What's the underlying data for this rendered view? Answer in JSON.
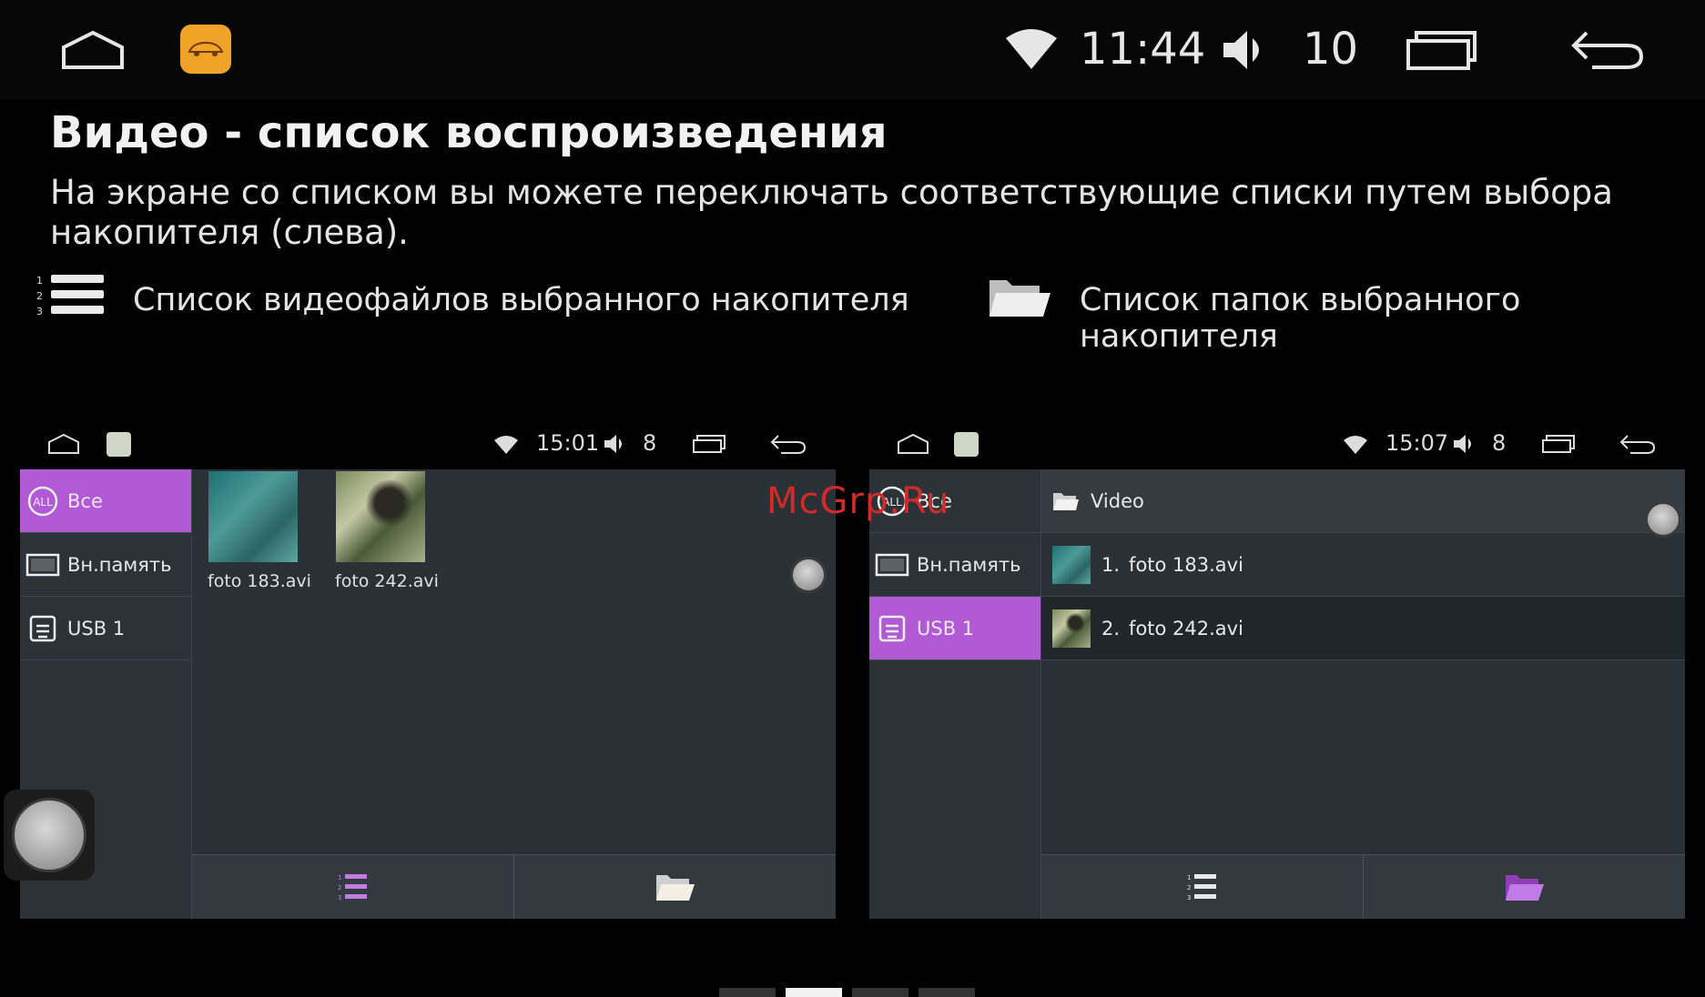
{
  "status_bar": {
    "time": "11:44",
    "volume": "10"
  },
  "heading": {
    "title": "Видео - список воспроизведения",
    "description": "На экране со списком вы можете переключать соответствующие списки путем выбора накопителя (слева)."
  },
  "legend": {
    "list_label": "Список видеофайлов выбранного накопителя",
    "folder_label": "Список папок выбранного накопителя"
  },
  "left_screen": {
    "time": "15:01",
    "volume": "8",
    "sidebar": [
      {
        "label": "Все",
        "icon": "all-icon",
        "active": true
      },
      {
        "label": "Вн.память",
        "icon": "memory-icon",
        "active": false
      },
      {
        "label": "USB 1",
        "icon": "usb-icon",
        "active": false
      }
    ],
    "files": [
      {
        "name": "foto 183.avi"
      },
      {
        "name": "foto 242.avi"
      }
    ]
  },
  "right_screen": {
    "time": "15:07",
    "volume": "8",
    "sidebar": [
      {
        "label": "Все",
        "icon": "all-icon",
        "active": false
      },
      {
        "label": "Вн.память",
        "icon": "memory-icon",
        "active": false
      },
      {
        "label": "USB 1",
        "icon": "usb-icon",
        "active": true
      }
    ],
    "folder": "Video",
    "items": [
      {
        "index": "1.",
        "name": "foto 183.avi"
      },
      {
        "index": "2.",
        "name": "foto 242.avi"
      }
    ]
  },
  "watermark": "McGrp.Ru",
  "colors": {
    "accent": "#b25ad6",
    "background": "#000000",
    "panel": "#2a3136"
  }
}
